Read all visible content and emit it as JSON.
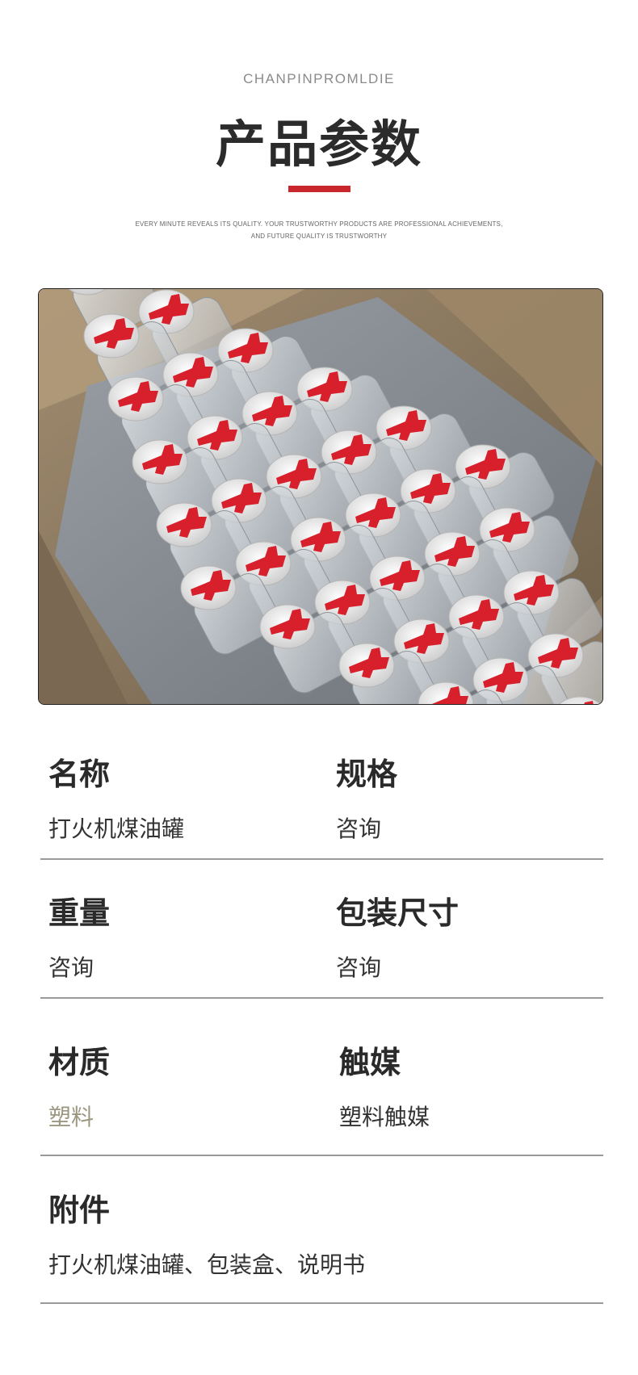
{
  "header": {
    "eyebrow": "CHANPINPROMLDIE",
    "title": "产品参数",
    "tagline_line1": "EVERY MINUTE REVEALS ITS QUALITY. YOUR TRUSTWORTHY PRODUCTS ARE PROFESSIONAL ACHIEVEMENTS,",
    "tagline_line2": "AND FUTURE QUALITY IS TRUSTWORTHY",
    "accent_color": "#c9262e"
  },
  "photo": {
    "description_icon": "product-photo",
    "cap_color": "#d8202c"
  },
  "specs": [
    {
      "label": "名称",
      "value": "打火机煤油罐"
    },
    {
      "label": "规格",
      "value": "咨询"
    },
    {
      "label": "重量",
      "value": "咨询"
    },
    {
      "label": "包装尺寸",
      "value": "咨询"
    },
    {
      "label": "材质",
      "value": "塑料"
    },
    {
      "label": "触媒",
      "value": "塑料触媒"
    },
    {
      "label": "附件",
      "value": "打火机煤油罐、包装盒、说明书"
    }
  ]
}
